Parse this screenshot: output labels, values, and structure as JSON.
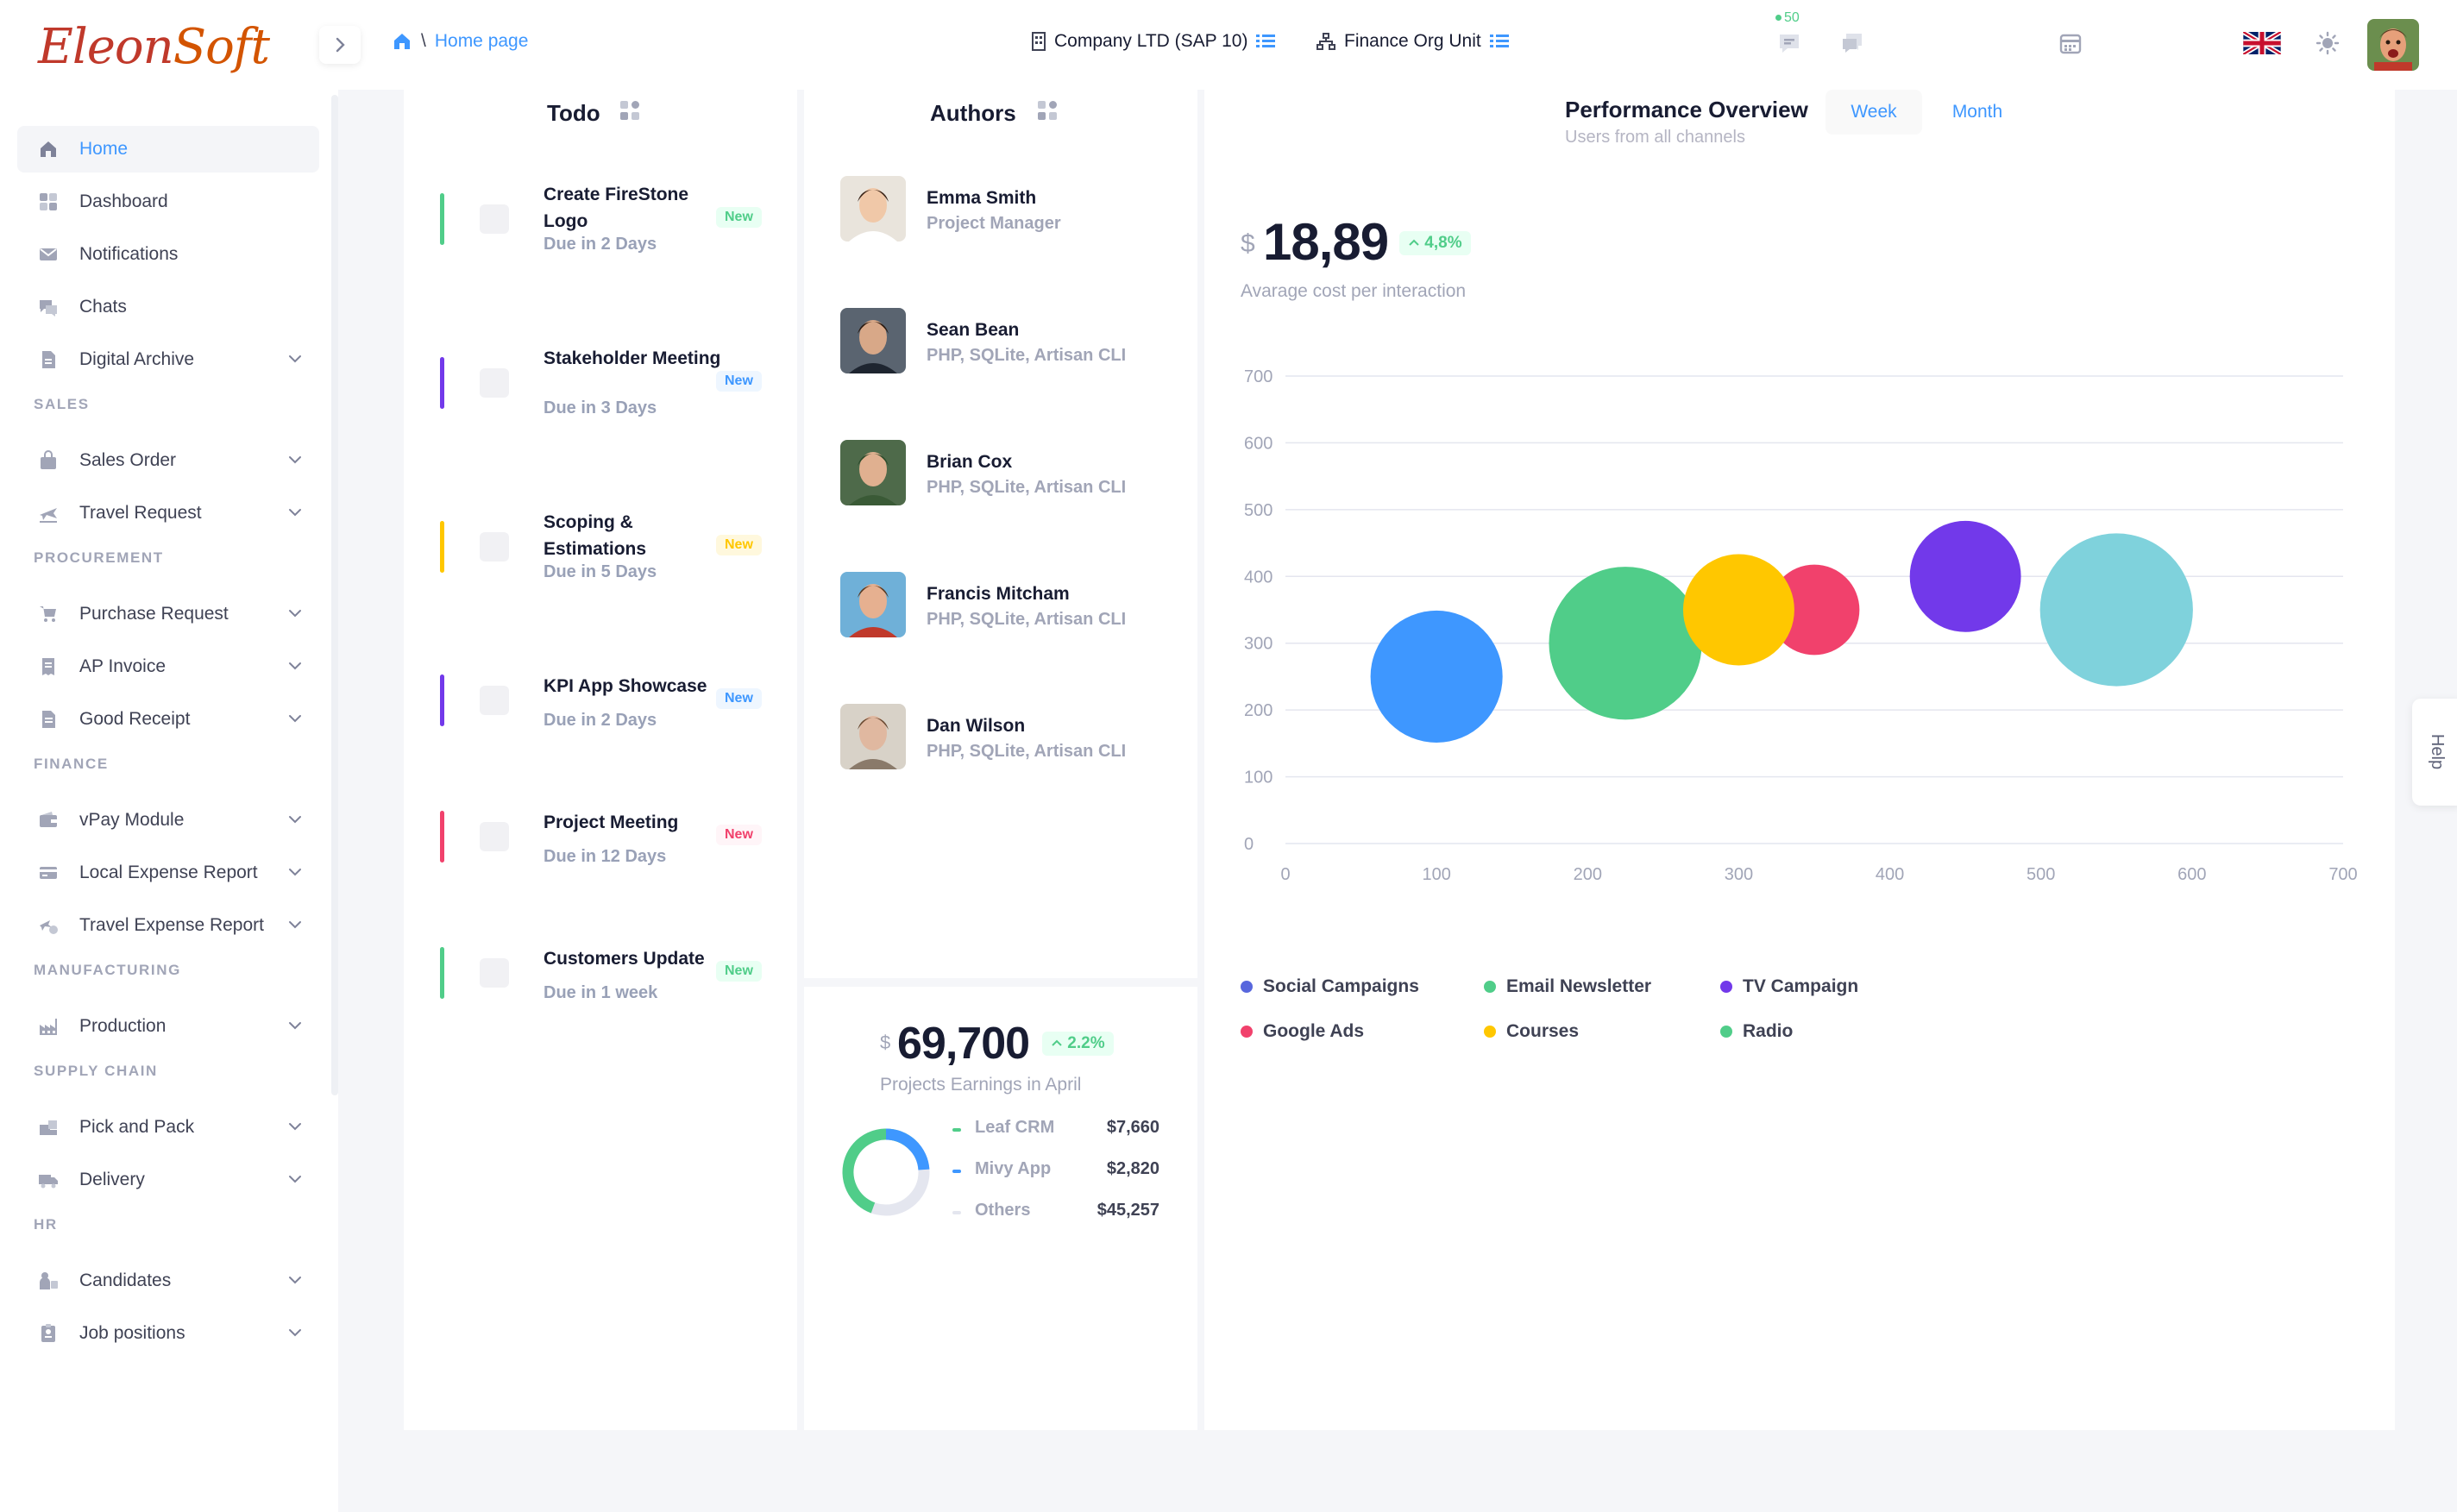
{
  "brand": {
    "logo_part1": "Eleon",
    "logo_part2": "Soft"
  },
  "header": {
    "breadcrumb_sep": "\\",
    "breadcrumb_page": "Home page",
    "company": "Company LTD (SAP 10)",
    "org_unit": "Finance Org Unit",
    "notification_count": "50",
    "icons": [
      "calendar-icon",
      "chat-notification-icon",
      "messages-icon",
      "uk-flag-icon",
      "theme-sun-icon",
      "user-avatar"
    ]
  },
  "sidebar": {
    "items": [
      {
        "label": "Home",
        "icon": "home-icon",
        "active": true
      },
      {
        "label": "Dashboard",
        "icon": "dashboard-icon"
      },
      {
        "label": "Notifications",
        "icon": "mail-icon"
      },
      {
        "label": "Chats",
        "icon": "chat-icon"
      },
      {
        "label": "Digital Archive",
        "icon": "document-icon",
        "chevron": true
      }
    ],
    "sections": [
      {
        "title": "SALES",
        "items": [
          {
            "label": "Sales Order",
            "icon": "bag-icon"
          },
          {
            "label": "Travel Request",
            "icon": "plane-icon"
          }
        ]
      },
      {
        "title": "PROCUREMENT",
        "items": [
          {
            "label": "Purchase Request",
            "icon": "cart-icon"
          },
          {
            "label": "AP Invoice",
            "icon": "invoice-icon"
          },
          {
            "label": "Good Receipt",
            "icon": "receipt-icon"
          }
        ]
      },
      {
        "title": "FINANCE",
        "items": [
          {
            "label": "vPay Module",
            "icon": "wallet-icon"
          },
          {
            "label": "Local Expense Report",
            "icon": "card-icon"
          },
          {
            "label": "Travel Expense Report",
            "icon": "travel-expense-icon"
          }
        ]
      },
      {
        "title": "MANUFACTURING",
        "items": [
          {
            "label": "Production",
            "icon": "factory-icon"
          }
        ]
      },
      {
        "title": "SUPPLY CHAIN",
        "items": [
          {
            "label": "Pick and Pack",
            "icon": "package-icon"
          },
          {
            "label": "Delivery",
            "icon": "truck-icon"
          }
        ]
      },
      {
        "title": "HR",
        "items": [
          {
            "label": "Candidates",
            "icon": "candidate-icon"
          },
          {
            "label": "Job positions",
            "icon": "badge-icon"
          }
        ]
      }
    ]
  },
  "todo": {
    "title": "Todo",
    "items": [
      {
        "title": "Create FireStone Logo",
        "due": "Due in 2 Days",
        "badge": "New",
        "color": "#50cd89",
        "badge_bg": "#e8fff3"
      },
      {
        "title": "Stakeholder Meeting",
        "due": "Due in 3 Days",
        "badge": "New",
        "color": "#7239ea",
        "badge_bg": "#eef6ff",
        "badge_fg": "#3e97ff"
      },
      {
        "title": "Scoping & Estimations",
        "due": "Due in 5 Days",
        "badge": "New",
        "color": "#ffc700",
        "badge_bg": "#fff8dd"
      },
      {
        "title": "KPI App Showcase",
        "due": "Due in 2 Days",
        "badge": "New",
        "color": "#7239ea",
        "badge_bg": "#eef6ff",
        "badge_fg": "#3e97ff"
      },
      {
        "title": "Project Meeting",
        "due": "Due in 12 Days",
        "badge": "New",
        "color": "#f1416c",
        "badge_bg": "#fff5f8"
      },
      {
        "title": "Customers Update",
        "due": "Due in 1 week",
        "badge": "New",
        "color": "#50cd89",
        "badge_bg": "#e8fff3"
      }
    ]
  },
  "authors": {
    "title": "Authors",
    "items": [
      {
        "name": "Emma Smith",
        "role": "Project Manager"
      },
      {
        "name": "Sean Bean",
        "role": "PHP, SQLite, Artisan CLI"
      },
      {
        "name": "Brian Cox",
        "role": "PHP, SQLite, Artisan CLI"
      },
      {
        "name": "Francis Mitcham",
        "role": "PHP, SQLite, Artisan CLI"
      },
      {
        "name": "Dan Wilson",
        "role": "PHP, SQLite, Artisan CLI"
      }
    ]
  },
  "earnings": {
    "currency": "$",
    "value": "69,700",
    "change": "2.2%",
    "caption": "Projects Earnings in April",
    "rows": [
      {
        "label": "Leaf CRM",
        "value": "$7,660",
        "color": "#50cd89"
      },
      {
        "label": "Mivy App",
        "value": "$2,820",
        "color": "#3e97ff"
      },
      {
        "label": "Others",
        "value": "$45,257",
        "color": "#e4e6ef"
      }
    ]
  },
  "performance": {
    "title": "Performance Overview",
    "subtitle": "Users from all channels",
    "tab_week": "Week",
    "tab_month": "Month",
    "currency": "$",
    "value": "18,89",
    "change": "4,8%",
    "caption": "Avarage cost per interaction"
  },
  "help": {
    "label": "Help"
  },
  "chart_data": {
    "type": "scatter",
    "subtype": "bubble",
    "xlim": [
      0,
      700
    ],
    "ylim": [
      0,
      700
    ],
    "xticks": [
      0,
      100,
      200,
      300,
      400,
      500,
      600,
      700
    ],
    "yticks": [
      0,
      100,
      200,
      300,
      400,
      500,
      600,
      700
    ],
    "grid": "horizontal",
    "legend_position": "bottom-left",
    "series": [
      {
        "name": "Social Campaigns",
        "x": 100,
        "y": 250,
        "size": 38,
        "color": "#3e97ff"
      },
      {
        "name": "Email Newsletter",
        "x": 225,
        "y": 300,
        "size": 44,
        "color": "#50cd89"
      },
      {
        "name": "TV Campaign",
        "x": 450,
        "y": 400,
        "size": 32,
        "color": "#7239ea"
      },
      {
        "name": "Google Ads",
        "x": 350,
        "y": 350,
        "size": 26,
        "color": "#f1416c"
      },
      {
        "name": "Courses",
        "x": 300,
        "y": 350,
        "size": 32,
        "color": "#ffc700"
      },
      {
        "name": "Radio",
        "x": 550,
        "y": 350,
        "size": 44,
        "color": "#7fd2dc"
      }
    ]
  }
}
